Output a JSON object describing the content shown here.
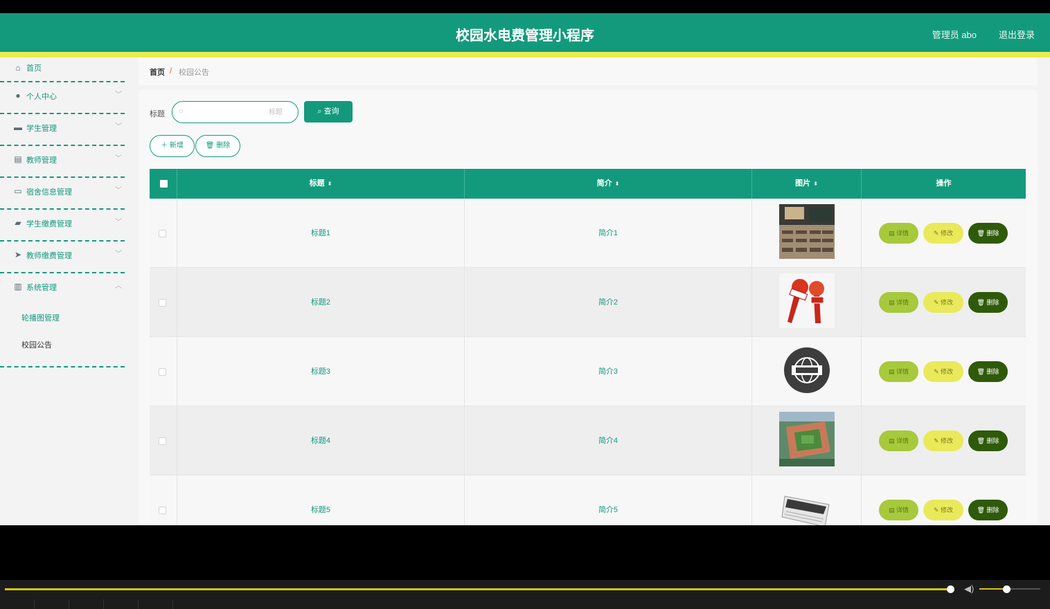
{
  "header": {
    "title": "校园水电费管理小程序",
    "user": "管理员 abo",
    "logout": "退出登录"
  },
  "sidebar": {
    "items": [
      {
        "label": "首页",
        "icon": "home-icon"
      },
      {
        "label": "个人中心",
        "icon": "user-icon"
      },
      {
        "label": "学生管理",
        "icon": "monitor-icon"
      },
      {
        "label": "教师管理",
        "icon": "clipboard-icon"
      },
      {
        "label": "宿舍信息管理",
        "icon": "chat-icon"
      },
      {
        "label": "学生缴费管理",
        "icon": "briefcase-icon"
      },
      {
        "label": "教师缴费管理",
        "icon": "send-icon"
      },
      {
        "label": "系统管理",
        "icon": "bar-chart-icon"
      }
    ],
    "submenu": [
      "轮播图管理",
      "校园公告"
    ]
  },
  "breadcrumb": {
    "home": "首页",
    "separator": "/",
    "current": "校园公告"
  },
  "search": {
    "label": "标题",
    "placeholder": "标题",
    "button": "查询"
  },
  "actions": {
    "add": "＋ 新增",
    "delete": "🗑 删除"
  },
  "table": {
    "headers": [
      "标题",
      "简介",
      "图片",
      "操作"
    ],
    "rows": [
      {
        "title": "标题1",
        "intro": "简介1",
        "image": "classroom"
      },
      {
        "title": "标题2",
        "intro": "简介2",
        "image": "microphones"
      },
      {
        "title": "标题3",
        "intro": "简介3",
        "image": "news-globe"
      },
      {
        "title": "标题4",
        "intro": "简介4",
        "image": "campus-aerial"
      },
      {
        "title": "标题5",
        "intro": "简介5",
        "image": "newspaper"
      }
    ],
    "op_labels": {
      "detail": "详情",
      "edit": "修改",
      "remove": "删除"
    }
  },
  "colors": {
    "primary": "#139a7c",
    "accent": "#e8ec4e",
    "detail": "#a7c93c",
    "edit": "#eae95a",
    "remove": "#2e5a0a"
  }
}
